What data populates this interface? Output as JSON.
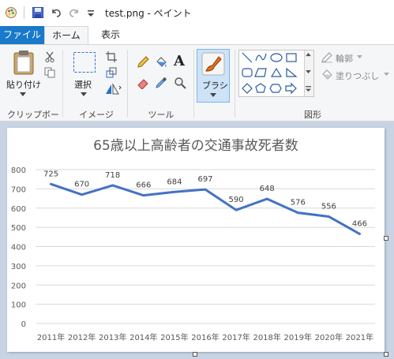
{
  "window": {
    "title": "test.png - ペイント"
  },
  "tabs": [
    "ファイル",
    "ホーム",
    "表示"
  ],
  "ribbon": {
    "clipboard": {
      "paste_label": "貼り付け",
      "group_label": "クリップボード"
    },
    "image": {
      "select_label": "選択",
      "group_label": "イメージ"
    },
    "tools": {
      "group_label": "ツール"
    },
    "brush": {
      "label": "ブラシ"
    },
    "shapes": {
      "outline_label": "輪郭",
      "fill_label": "塗りつぶし",
      "group_label": "図形"
    }
  },
  "colors": {
    "accent": "#1979ca",
    "line": "#4472c4"
  },
  "chart_data": {
    "type": "line",
    "title": "65歳以上高齢者の交通事故死者数",
    "categories": [
      "2011年",
      "2012年",
      "2013年",
      "2014年",
      "2015年",
      "2016年",
      "2017年",
      "2018年",
      "2019年",
      "2020年",
      "2021年"
    ],
    "values": [
      725,
      670,
      718,
      666,
      684,
      697,
      590,
      648,
      576,
      556,
      466
    ],
    "ylim": [
      0,
      800
    ],
    "yticks": [
      "0",
      "100",
      "200",
      "300",
      "400",
      "500",
      "600",
      "700",
      "800"
    ],
    "grid": true,
    "legend": false
  }
}
